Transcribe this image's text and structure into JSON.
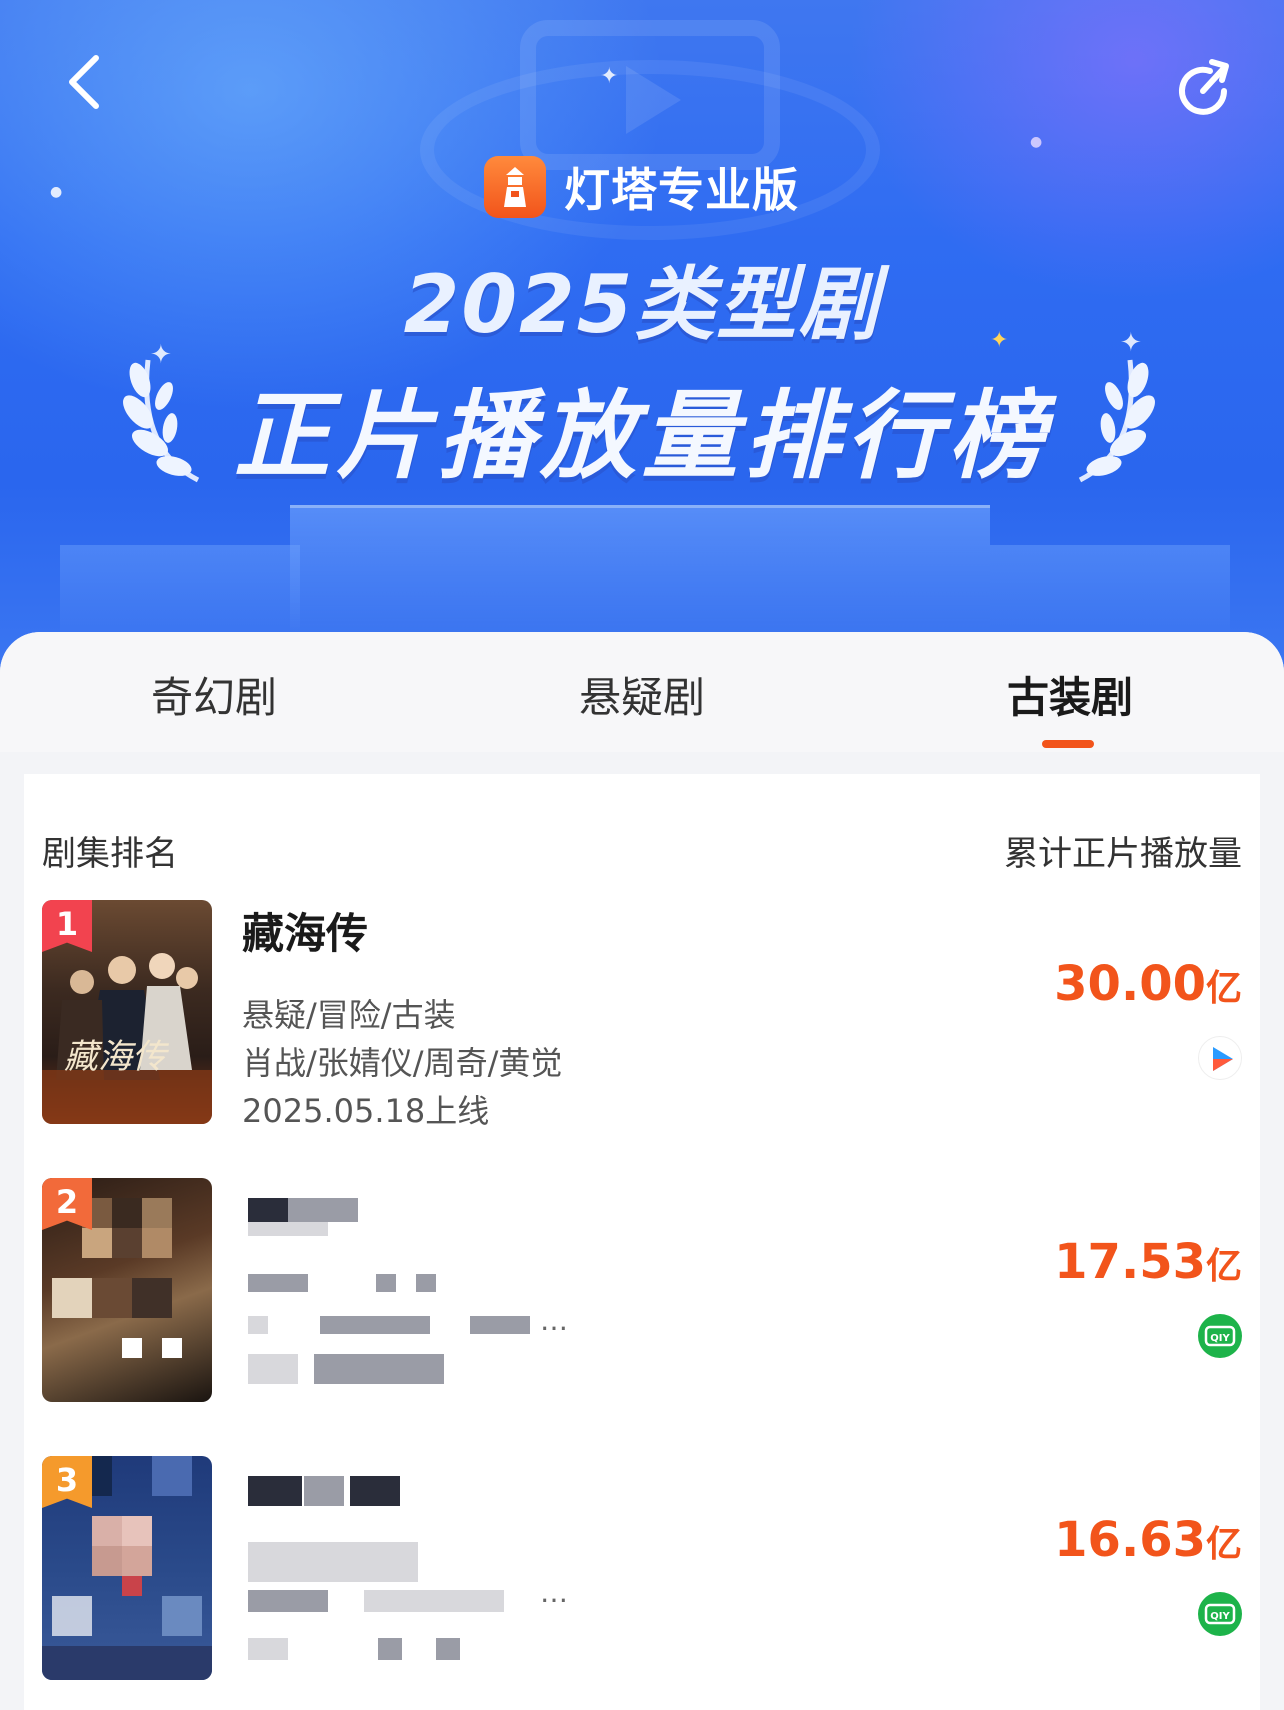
{
  "header": {
    "brand_name": "灯塔专业版",
    "title_year": "2025类型剧",
    "title_main": "正片播放量排行榜",
    "back_icon": "chevron-left-icon",
    "share_icon": "share-icon"
  },
  "tabs": [
    {
      "label": "奇幻剧",
      "active": false
    },
    {
      "label": "悬疑剧",
      "active": false
    },
    {
      "label": "古装剧",
      "active": true
    }
  ],
  "list": {
    "col_left": "剧集排名",
    "col_right": "累计正片播放量",
    "rows": [
      {
        "rank": "1",
        "title": "藏海传",
        "genres": "悬疑/冒险/古装",
        "cast": "肖战/张婧仪/周奇/黄觉",
        "release": "2025.05.18上线",
        "views": "30.00",
        "unit": "亿",
        "platform": "youku-icon",
        "poster_text": "藏海传"
      },
      {
        "rank": "2",
        "title": "",
        "views": "17.53",
        "unit": "亿",
        "platform": "iqiyi-icon",
        "ellipsis": "…"
      },
      {
        "rank": "3",
        "title": "",
        "views": "16.63",
        "unit": "亿",
        "platform": "iqiyi-icon",
        "ellipsis": "…"
      }
    ]
  },
  "colors": {
    "accent": "#f2541b",
    "banner": "#2f6cf2",
    "rank1": "#f2434f",
    "rank2": "#f26a3a",
    "rank3": "#f59a2c",
    "iqiyi": "#1db34a"
  }
}
